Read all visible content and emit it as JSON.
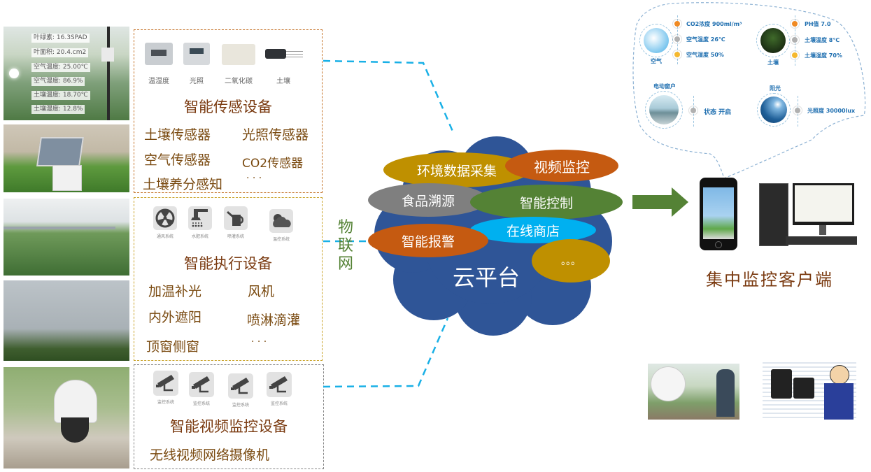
{
  "sensing": {
    "title": "智能传感设备",
    "sensor_types": [
      "温湿度",
      "光照",
      "二氧化碳",
      "土壤"
    ],
    "items": [
      "土壤传感器",
      "光照传感器",
      "空气传感器",
      "CO2传感器",
      "土壤养分感知",
      "· · ·"
    ],
    "photo_readings": [
      "叶绿素: 16.3SPAD",
      "叶面积: 20.4.cm2",
      "空气温度: 25.00℃",
      "空气湿度: 86.9%",
      "土壤温度: 18.70℃",
      "土壤湿度: 12.8%"
    ]
  },
  "actuation": {
    "title": "智能执行设备",
    "icon_captions": [
      "通风系统",
      "水肥系统",
      "喷灌系统",
      "温控系统"
    ],
    "icons": [
      "radiation-fan-icon",
      "shower-icon",
      "watering-can-icon",
      "weather-cloud-icon"
    ],
    "items": [
      "加温补光",
      "风机",
      "内外遮阳",
      "喷淋滴灌",
      "顶窗侧窗",
      "· · ·"
    ]
  },
  "video": {
    "title": "智能视频监控设备",
    "icon_captions": [
      "监控系统",
      "监控系统",
      "监控系统",
      "监控系统"
    ],
    "items": [
      "无线视频网络摄像机"
    ]
  },
  "iot_label": [
    "物",
    "联",
    "网"
  ],
  "cloud": {
    "title": "云平台",
    "services": [
      {
        "label": "环境数据采集",
        "color": "#bf9000"
      },
      {
        "label": "视频监控",
        "color": "#c55a11"
      },
      {
        "label": "食品溯源",
        "color": "#7f7f7f"
      },
      {
        "label": "智能控制",
        "color": "#548235"
      },
      {
        "label": "在线商店",
        "color": "#00b0f0"
      },
      {
        "label": "智能报警",
        "color": "#c55a11"
      },
      {
        "label": "。。。",
        "color": "#bf9000"
      }
    ],
    "cloud_color": "#2f5597"
  },
  "client": {
    "title": "集中监控客户端",
    "arrow_color": "#548235"
  },
  "monitor_panel": {
    "air": {
      "label": "空气",
      "readings": [
        "CO2浓度 900ml/m³",
        "空气温度  26℃",
        "空气湿度 50%"
      ]
    },
    "soil": {
      "label": "土壤",
      "readings": [
        "PH值 7.0",
        "土壤温度  8℃",
        "土壤湿度 70%"
      ]
    },
    "window": {
      "label": "电动窗户",
      "readings": [
        "状态  开启"
      ]
    },
    "sunlight": {
      "label": "阳光",
      "readings": [
        "光照度  30000lux"
      ]
    }
  },
  "colors": {
    "link_dash": "#19b0e6",
    "reading_text": "#1f6fb0",
    "dot_orange": "#f08a24",
    "dot_gray": "#b0b0b0",
    "dot_yellow": "#f5b82e"
  }
}
